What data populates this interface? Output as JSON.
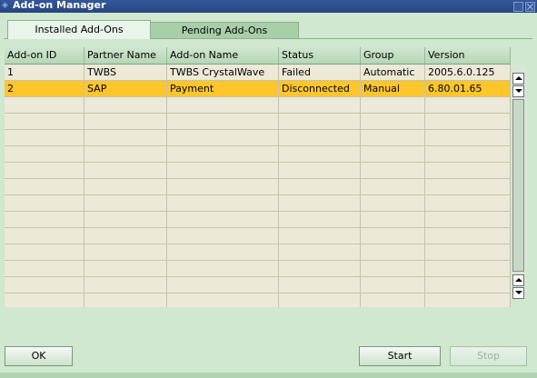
{
  "window": {
    "title": "Add-on Manager"
  },
  "tabs": [
    {
      "label": "Installed Add-Ons",
      "active": true
    },
    {
      "label": "Pending Add-Ons",
      "active": false
    }
  ],
  "table": {
    "columns": [
      "Add-on ID",
      "Partner Name",
      "Add-on Name",
      "Status",
      "Group",
      "Version"
    ],
    "rows": [
      [
        "1",
        "TWBS",
        "TWBS CrystalWave",
        "Failed",
        "Automatic",
        "2005.6.0.125"
      ],
      [
        "2",
        "SAP",
        "Payment",
        "Disconnected",
        "Manual",
        "6.80.01.65"
      ]
    ],
    "selected_row": 2,
    "selected_color": "#ffc62c"
  },
  "buttons": {
    "ok": "OK",
    "start": "Start",
    "stop": "Stop"
  }
}
